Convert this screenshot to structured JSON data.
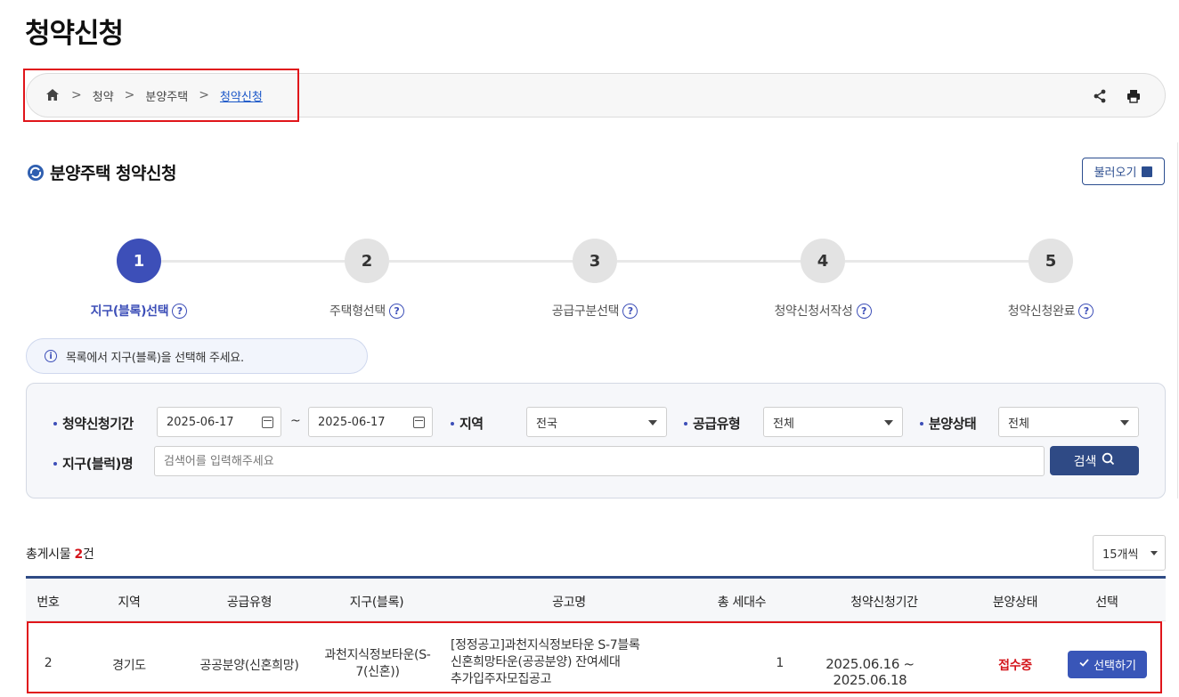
{
  "page_title": "청약신청",
  "breadcrumb": {
    "items": [
      "청약",
      "분양주택",
      "청약신청"
    ],
    "separator": ">"
  },
  "section": {
    "title": "분양주택 청약신청",
    "load_button": "불러오기"
  },
  "steps": [
    {
      "number": "1",
      "label": "지구(블록)선택",
      "active": true
    },
    {
      "number": "2",
      "label": "주택형선택",
      "active": false
    },
    {
      "number": "3",
      "label": "공급구분선택",
      "active": false
    },
    {
      "number": "4",
      "label": "청약신청서작성",
      "active": false
    },
    {
      "number": "5",
      "label": "청약신청완료",
      "active": false
    }
  ],
  "info_message": "목록에서 지구(블록)을 선택해 주세요.",
  "filters": {
    "period_label": "청약신청기간",
    "date_from": "2025-06-17",
    "date_to": "2025-06-17",
    "tilde": "~",
    "region_label": "지역",
    "region_value": "전국",
    "supply_type_label": "공급유형",
    "supply_type_value": "전체",
    "status_label": "분양상태",
    "status_value": "전체",
    "block_label": "지구(블럭)명",
    "block_placeholder": "검색어를 입력해주세요",
    "search_button": "검색"
  },
  "total": {
    "prefix": "총게시물 ",
    "count": "2",
    "suffix": "건"
  },
  "per_page": "15개씩",
  "table": {
    "headers": [
      "번호",
      "지역",
      "공급유형",
      "지구(블록)",
      "공고명",
      "총 세대수",
      "청약신청기간",
      "분양상태",
      "선택"
    ],
    "rows": [
      {
        "no": "2",
        "region": "경기도",
        "supply_type": "공공분양(신혼희망)",
        "block_line1": "과천지식정보타운(S-",
        "block_line2": "7(신혼))",
        "notice_line1": "[정정공고]과천지식정보타운 S-7블록",
        "notice_line2": "신혼희망타운(공공분양) 잔여세대",
        "notice_line3": "추가입주자모집공고",
        "households": "1",
        "period": "2025.06.16 ~ 2025.06.18",
        "status": "접수중",
        "select_label": "선택하기"
      }
    ]
  },
  "colors": {
    "accent": "#3d4fb8",
    "navy": "#2f4a85",
    "status_red": "#d4151b",
    "highlight_red": "#e0151a"
  }
}
